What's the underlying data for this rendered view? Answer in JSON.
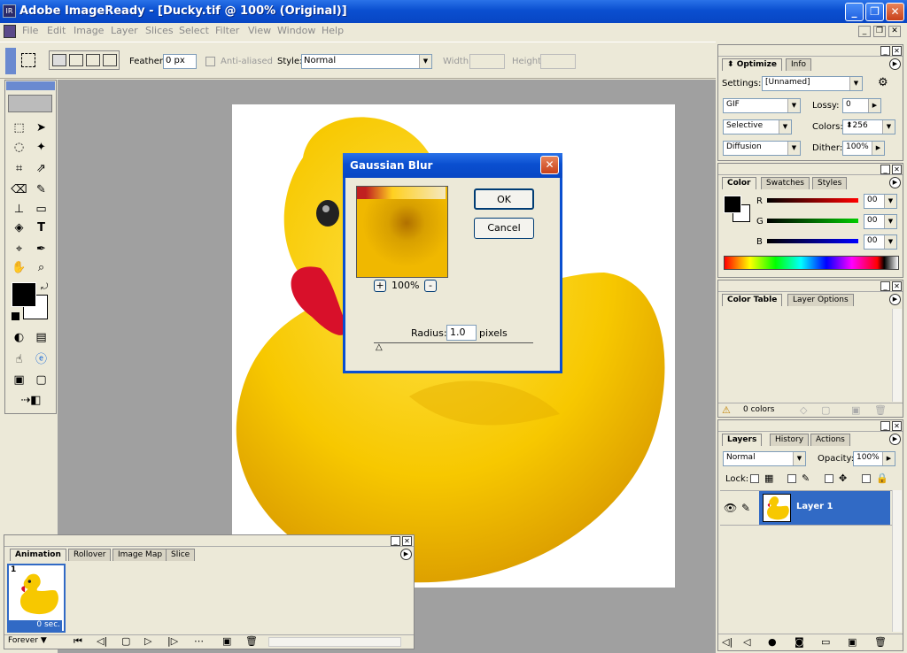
{
  "window": {
    "title": "Adobe ImageReady - [Ducky.tif @ 100% (Original)]",
    "app_icon": "imageready-icon"
  },
  "menu": [
    "File",
    "Edit",
    "Image",
    "Layer",
    "Slices",
    "Select",
    "Filter",
    "View",
    "Window",
    "Help"
  ],
  "options": {
    "feather_label": "Feather:",
    "feather_value": "0 px",
    "antialiased_label": "Anti-aliased",
    "style_label": "Style:",
    "style_value": "Normal",
    "width_label": "Width:",
    "height_label": "Height:"
  },
  "optimize": {
    "tabs": [
      "Optimize",
      "Info"
    ],
    "settings_label": "Settings:",
    "settings_value": "[Unnamed]",
    "format": "GIF",
    "lossy_label": "Lossy:",
    "lossy_value": "0",
    "palette": "Selective",
    "colors_label": "Colors:",
    "colors_value": "256",
    "dither_algo": "Diffusion",
    "dither_label": "Dither:",
    "dither_value": "100%"
  },
  "color": {
    "tabs": [
      "Color",
      "Swatches",
      "Styles"
    ],
    "r_label": "R",
    "g_label": "G",
    "b_label": "B",
    "r_value": "00",
    "g_value": "00",
    "b_value": "00"
  },
  "color_table": {
    "tabs": [
      "Color Table",
      "Layer Options"
    ],
    "status": "0 colors"
  },
  "layers": {
    "tabs": [
      "Layers",
      "History",
      "Actions"
    ],
    "blend": "Normal",
    "opacity_label": "Opacity:",
    "opacity_value": "100%",
    "lock_label": "Lock:",
    "layer_name": "Layer 1"
  },
  "animation": {
    "tabs": [
      "Animation",
      "Rollover",
      "Image Map",
      "Slice"
    ],
    "frame_number": "1",
    "frame_delay": "0 sec.",
    "loop": "Forever"
  },
  "dialog": {
    "title": "Gaussian Blur",
    "ok": "OK",
    "cancel": "Cancel",
    "zoom": "100%",
    "plus": "+",
    "minus": "-",
    "radius_label": "Radius:",
    "radius_value": "1.0",
    "radius_unit": "pixels"
  },
  "colors": {
    "titlebar": "#0a4fd0",
    "duck_yellow": "#f7c800",
    "layer_highlight": "#316ac5"
  }
}
